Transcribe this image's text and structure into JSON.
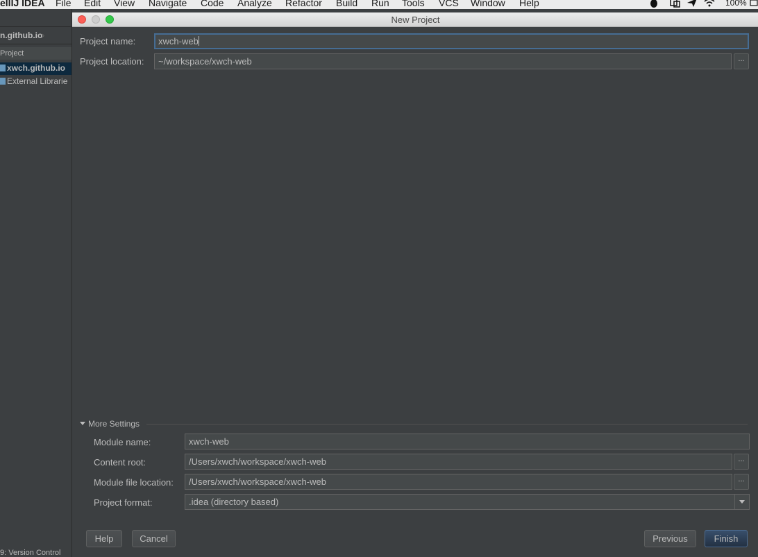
{
  "menubar": {
    "app_name": "ellIJ IDEA",
    "items": [
      "File",
      "Edit",
      "View",
      "Navigate",
      "Code",
      "Analyze",
      "Refactor",
      "Build",
      "Run",
      "Tools",
      "VCS",
      "Window",
      "Help"
    ],
    "battery": "100%"
  },
  "ide": {
    "breadcrumb": "n.github.io",
    "project_tab": "Project",
    "tree": [
      "xwch.github.io",
      "External Librarie"
    ],
    "version_control": "9: Version Control"
  },
  "dialog": {
    "title": "New Project",
    "project_name_label": "Project name:",
    "project_name_value": "xwch-web",
    "project_location_label": "Project location:",
    "project_location_value": "~/workspace/xwch-web",
    "browse_label": "...",
    "more_settings_label": "More Settings",
    "module_name_label": "Module name:",
    "module_name_value": "xwch-web",
    "content_root_label": "Content root:",
    "content_root_value": "/Users/xwch/workspace/xwch-web",
    "module_file_location_label": "Module file location:",
    "module_file_location_value": "/Users/xwch/workspace/xwch-web",
    "project_format_label": "Project format:",
    "project_format_value": ".idea (directory based)",
    "buttons": {
      "help": "Help",
      "cancel": "Cancel",
      "previous": "Previous",
      "finish": "Finish"
    }
  }
}
